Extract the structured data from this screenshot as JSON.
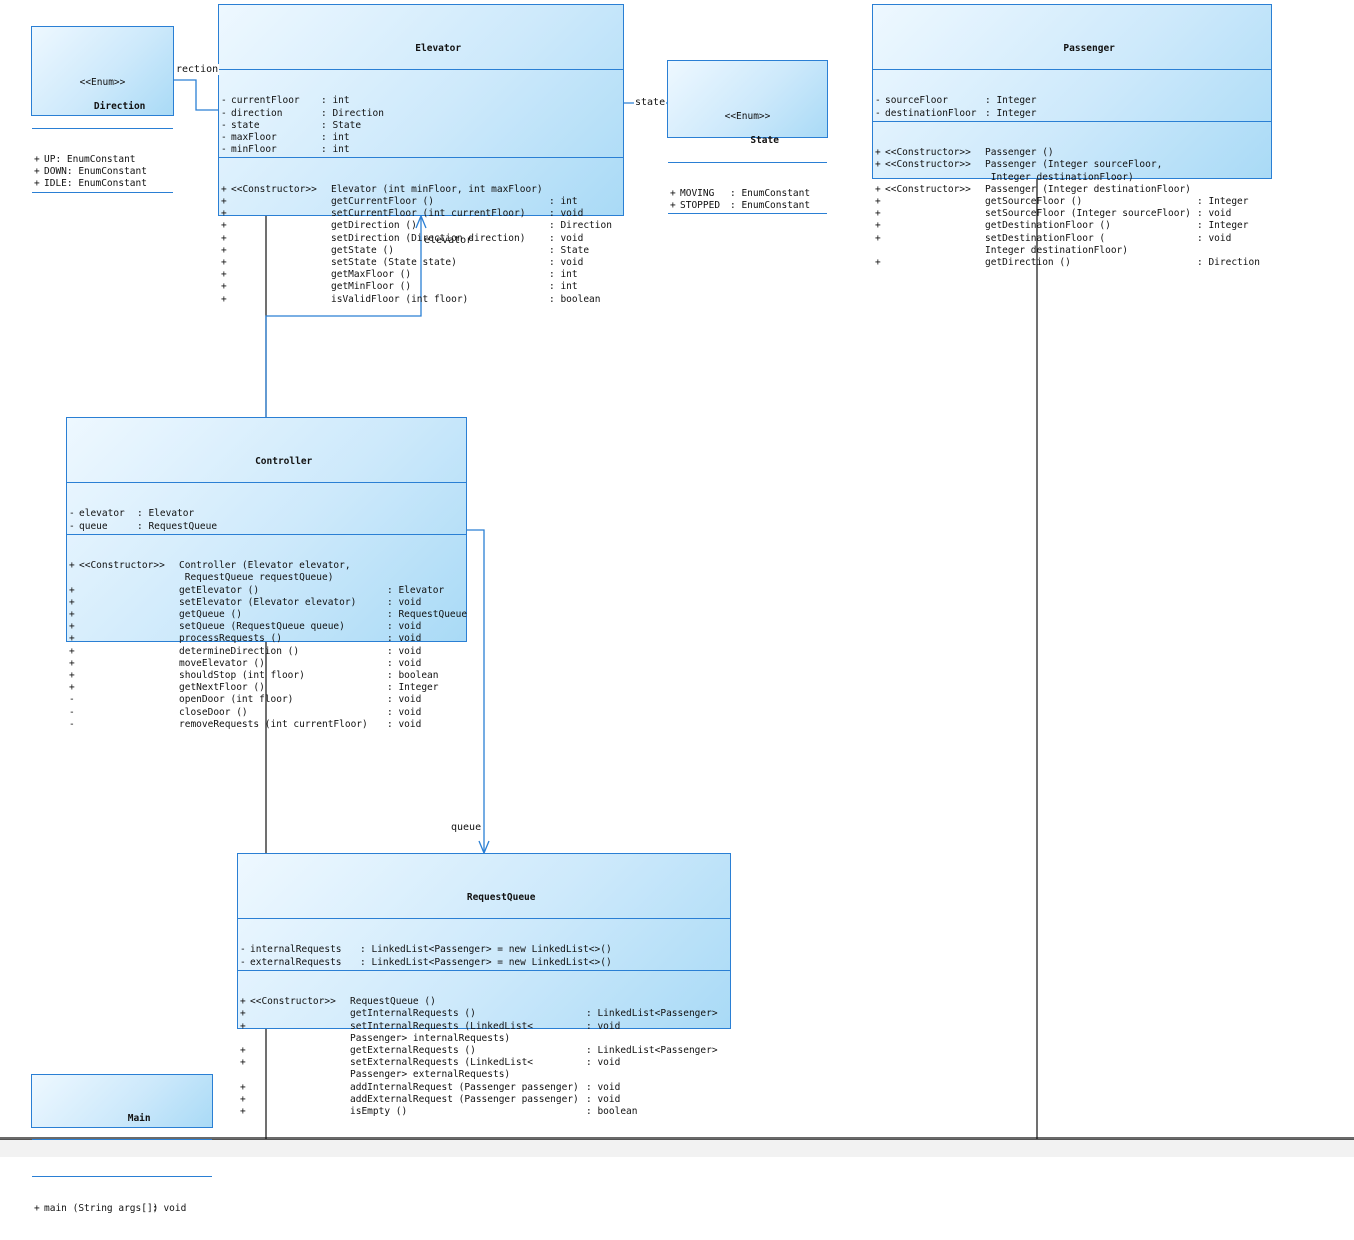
{
  "classes": {
    "direction": {
      "stereotype": "<<Enum>>",
      "name": "Direction",
      "attributes": [
        {
          "vis": "+",
          "name": "UP",
          "type": ": EnumConstant"
        },
        {
          "vis": "+",
          "name": "DOWN",
          "type": ": EnumConstant"
        },
        {
          "vis": "+",
          "name": "IDLE",
          "type": ": EnumConstant"
        }
      ],
      "operations": []
    },
    "elevator": {
      "name": "Elevator",
      "attributes": [
        {
          "vis": "-",
          "name": "currentFloor",
          "type": ": int"
        },
        {
          "vis": "-",
          "name": "direction",
          "type": ": Direction"
        },
        {
          "vis": "-",
          "name": "state",
          "type": ": State"
        },
        {
          "vis": "-",
          "name": "maxFloor",
          "type": ": int"
        },
        {
          "vis": "-",
          "name": "minFloor",
          "type": ": int"
        }
      ],
      "operations": [
        {
          "vis": "+",
          "stereo": "<<Constructor>>",
          "name": "Elevator (int minFloor, int maxFloor)",
          "type": ""
        },
        {
          "vis": "+",
          "stereo": "",
          "name": "getCurrentFloor ()",
          "type": ": int"
        },
        {
          "vis": "+",
          "stereo": "",
          "name": "setCurrentFloor (int currentFloor)",
          "type": ": void"
        },
        {
          "vis": "+",
          "stereo": "",
          "name": "getDirection ()",
          "type": ": Direction"
        },
        {
          "vis": "+",
          "stereo": "",
          "name": "setDirection (Direction direction)",
          "type": ": void"
        },
        {
          "vis": "+",
          "stereo": "",
          "name": "getState ()",
          "type": ": State"
        },
        {
          "vis": "+",
          "stereo": "",
          "name": "setState (State state)",
          "type": ": void"
        },
        {
          "vis": "+",
          "stereo": "",
          "name": "getMaxFloor ()",
          "type": ": int"
        },
        {
          "vis": "+",
          "stereo": "",
          "name": "getMinFloor ()",
          "type": ": int"
        },
        {
          "vis": "+",
          "stereo": "",
          "name": "isValidFloor (int floor)",
          "type": ": boolean"
        }
      ]
    },
    "state": {
      "stereotype": "<<Enum>>",
      "name": "State",
      "attributes": [
        {
          "vis": "+",
          "name": "MOVING",
          "type": ": EnumConstant"
        },
        {
          "vis": "+",
          "name": "STOPPED",
          "type": ": EnumConstant"
        }
      ],
      "operations": []
    },
    "passenger": {
      "name": "Passenger",
      "attributes": [
        {
          "vis": "-",
          "name": "sourceFloor",
          "type": ": Integer"
        },
        {
          "vis": "-",
          "name": "destinationFloor",
          "type": ": Integer"
        }
      ],
      "operations": [
        {
          "vis": "+",
          "stereo": "<<Constructor>>",
          "name": "Passenger ()",
          "type": ""
        },
        {
          "vis": "+",
          "stereo": "<<Constructor>>",
          "name": "Passenger (Integer sourceFloor,",
          "type": ""
        },
        {
          "vis": "",
          "stereo": "",
          "name": " Integer destinationFloor)",
          "type": ""
        },
        {
          "vis": "+",
          "stereo": "<<Constructor>>",
          "name": "Passenger (Integer destinationFloor)",
          "type": ""
        },
        {
          "vis": "+",
          "stereo": "",
          "name": "getSourceFloor ()",
          "type": ": Integer"
        },
        {
          "vis": "+",
          "stereo": "",
          "name": "setSourceFloor (Integer sourceFloor)",
          "type": ": void"
        },
        {
          "vis": "+",
          "stereo": "",
          "name": "getDestinationFloor ()",
          "type": ": Integer"
        },
        {
          "vis": "+",
          "stereo": "",
          "name": "setDestinationFloor (",
          "type": ": void"
        },
        {
          "vis": "",
          "stereo": "",
          "name": "Integer destinationFloor)",
          "type": ""
        },
        {
          "vis": "+",
          "stereo": "",
          "name": "getDirection ()",
          "type": ": Direction"
        }
      ]
    },
    "controller": {
      "name": "Controller",
      "attributes": [
        {
          "vis": "-",
          "name": "elevator",
          "type": ": Elevator"
        },
        {
          "vis": "-",
          "name": "queue",
          "type": ": RequestQueue"
        }
      ],
      "operations": [
        {
          "vis": "+",
          "stereo": "<<Constructor>>",
          "name": "Controller (Elevator elevator,",
          "type": ""
        },
        {
          "vis": "",
          "stereo": "",
          "name": " RequestQueue requestQueue)",
          "type": ""
        },
        {
          "vis": "+",
          "stereo": "",
          "name": "getElevator ()",
          "type": ": Elevator"
        },
        {
          "vis": "+",
          "stereo": "",
          "name": "setElevator (Elevator elevator)",
          "type": ": void"
        },
        {
          "vis": "+",
          "stereo": "",
          "name": "getQueue ()",
          "type": ": RequestQueue"
        },
        {
          "vis": "+",
          "stereo": "",
          "name": "setQueue (RequestQueue queue)",
          "type": ": void"
        },
        {
          "vis": "+",
          "stereo": "",
          "name": "processRequests ()",
          "type": ": void"
        },
        {
          "vis": "+",
          "stereo": "",
          "name": "determineDirection ()",
          "type": ": void"
        },
        {
          "vis": "+",
          "stereo": "",
          "name": "moveElevator ()",
          "type": ": void"
        },
        {
          "vis": "+",
          "stereo": "",
          "name": "shouldStop (int floor)",
          "type": ": boolean"
        },
        {
          "vis": "+",
          "stereo": "",
          "name": "getNextFloor ()",
          "type": ": Integer"
        },
        {
          "vis": "-",
          "stereo": "",
          "name": "openDoor (int floor)",
          "type": ": void"
        },
        {
          "vis": "-",
          "stereo": "",
          "name": "closeDoor ()",
          "type": ": void"
        },
        {
          "vis": "-",
          "stereo": "",
          "name": "removeRequests (int currentFloor)",
          "type": ": void"
        }
      ]
    },
    "request_queue": {
      "name": "RequestQueue",
      "attributes": [
        {
          "vis": "-",
          "name": "internalRequests",
          "type": ": LinkedList<Passenger> = new LinkedList<>()"
        },
        {
          "vis": "-",
          "name": "externalRequests",
          "type": ": LinkedList<Passenger> = new LinkedList<>()"
        }
      ],
      "operations": [
        {
          "vis": "+",
          "stereo": "<<Constructor>>",
          "name": "RequestQueue ()",
          "type": ""
        },
        {
          "vis": "+",
          "stereo": "",
          "name": "getInternalRequests ()",
          "type": ": LinkedList<Passenger>"
        },
        {
          "vis": "+",
          "stereo": "",
          "name": "setInternalRequests (LinkedList<",
          "type": ": void"
        },
        {
          "vis": "",
          "stereo": "",
          "name": "Passenger> internalRequests)",
          "type": ""
        },
        {
          "vis": "+",
          "stereo": "",
          "name": "getExternalRequests ()",
          "type": ": LinkedList<Passenger>"
        },
        {
          "vis": "+",
          "stereo": "",
          "name": "setExternalRequests (LinkedList<",
          "type": ": void"
        },
        {
          "vis": "",
          "stereo": "",
          "name": "Passenger> externalRequests)",
          "type": ""
        },
        {
          "vis": "+",
          "stereo": "",
          "name": "addInternalRequest (Passenger passenger)",
          "type": ": void"
        },
        {
          "vis": "+",
          "stereo": "",
          "name": "addExternalRequest (Passenger passenger)",
          "type": ": void"
        },
        {
          "vis": "+",
          "stereo": "",
          "name": "isEmpty ()",
          "type": ": boolean"
        }
      ]
    },
    "main": {
      "name": "Main",
      "attributes": [],
      "operations": [
        {
          "vis": "+",
          "stereo": "",
          "name": "main (String args[])",
          "type": ": void"
        }
      ]
    }
  },
  "associations": {
    "direction_role": "rection",
    "state_role": "state",
    "elevator_role": "elevator",
    "queue_role": "queue"
  },
  "colors": {
    "border": "#2a7fd4",
    "fill_light": "#eef8ff",
    "fill_dark": "#a9daf6",
    "line": "#2a7fd4"
  }
}
